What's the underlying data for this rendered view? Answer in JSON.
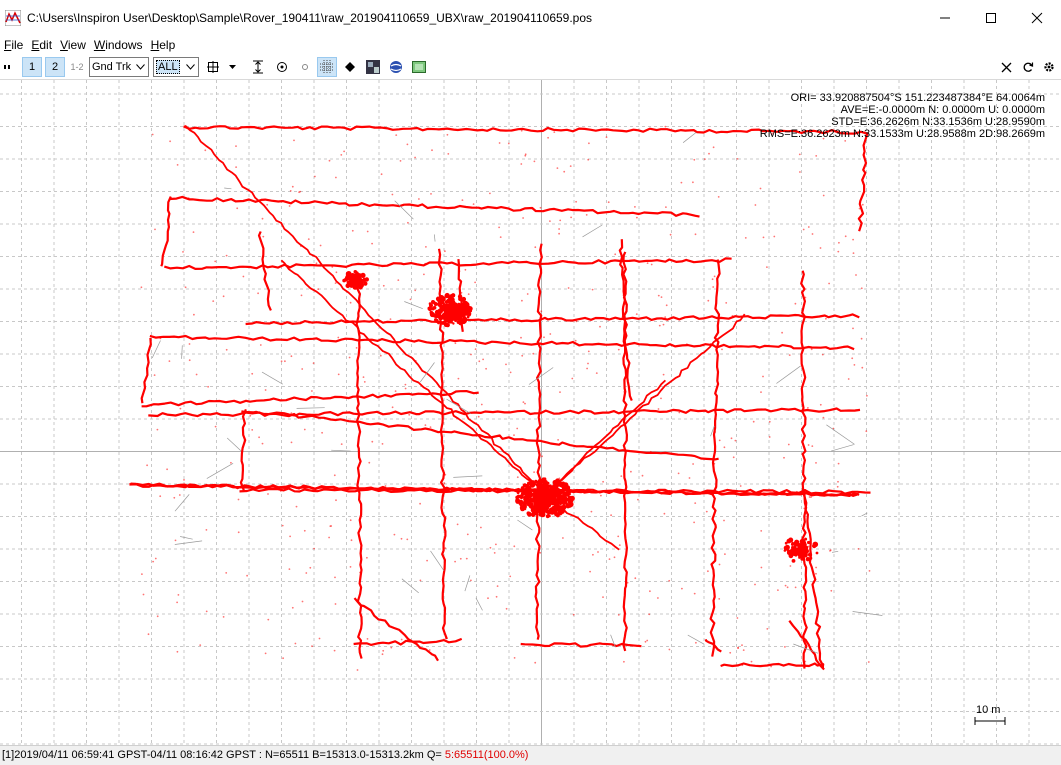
{
  "window": {
    "title": "C:\\Users\\Inspiron User\\Desktop\\Sample\\Rover_190411\\raw_201904110659_UBX\\raw_201904110659.pos",
    "app_icon": "rtkplot-icon"
  },
  "menu": [
    {
      "mnemonic": "F",
      "rest": "ile"
    },
    {
      "mnemonic": "E",
      "rest": "dit"
    },
    {
      "mnemonic": "V",
      "rest": "iew"
    },
    {
      "mnemonic": "W",
      "rest": "indows"
    },
    {
      "mnemonic": "H",
      "rest": "elp"
    }
  ],
  "toolbar": {
    "btn1": "1",
    "btn2": "2",
    "btn12": "1-2",
    "plot_type": "Gnd Trk",
    "quality_filter": "ALL"
  },
  "plot": {
    "ori": "ORI= 33.920887504°S  151.223487384°E 64.0064m",
    "ave": "AVE=E:-0.0000m N: 0.0000m U: 0.0000m",
    "std": "STD=E:36.2626m N:33.1536m U:28.9590m",
    "rms": "RMS=E:36.2623m N:33.1533m U:28.9588m 2D:98.2669m",
    "scale": "10 m",
    "track_color": "#ff0000",
    "grid_color": "#c8c8c8"
  },
  "status": {
    "range": "[1]2019/04/11 06:59:41 GPST-04/11 08:16:42 GPST : N=65511 B=15313.0-15313.2km Q= ",
    "quality": "5:65511(100.0%)"
  }
}
